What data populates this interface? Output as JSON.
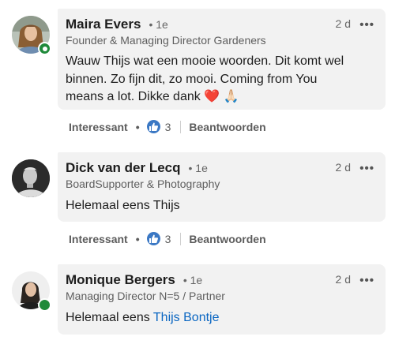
{
  "comments": [
    {
      "name": "Maira Evers",
      "degree": "• 1e",
      "time": "2 d",
      "more": "•••",
      "headline": "Founder & Managing Director Gardeners",
      "text_lines": [
        "Wauw Thijs wat een mooie woorden. Dit komt wel",
        "binnen. Zo fijn dit, zo mooi. Coming from You",
        "means a lot. Dikke dank ❤️ 🙏🏻"
      ],
      "actions": {
        "interesting": "Interessant",
        "separator": "•",
        "reaction_count": "3",
        "reply": "Beantwoorden"
      },
      "online": true
    },
    {
      "name": "Dick van der Lecq",
      "degree": "• 1e",
      "time": "2 d",
      "more": "•••",
      "headline": "BoardSupporter & Photography",
      "text_lines": [
        "Helemaal eens Thijs"
      ],
      "actions": {
        "interesting": "Interessant",
        "separator": "•",
        "reaction_count": "3",
        "reply": "Beantwoorden"
      },
      "online": false
    },
    {
      "name": "Monique Bergers",
      "degree": "• 1e",
      "time": "2 d",
      "more": "•••",
      "headline": "Managing Director N=5 / Partner",
      "text_prefix": "Helemaal eens ",
      "mention": "Thijs Bontje",
      "online": true
    }
  ],
  "icons": {
    "reaction": "like-icon",
    "menu": "more-options-icon"
  },
  "colors": {
    "bubble": "#f2f2f2",
    "mention": "#0a66c2",
    "online": "#1f8a3a",
    "like": "#3b78c4"
  }
}
